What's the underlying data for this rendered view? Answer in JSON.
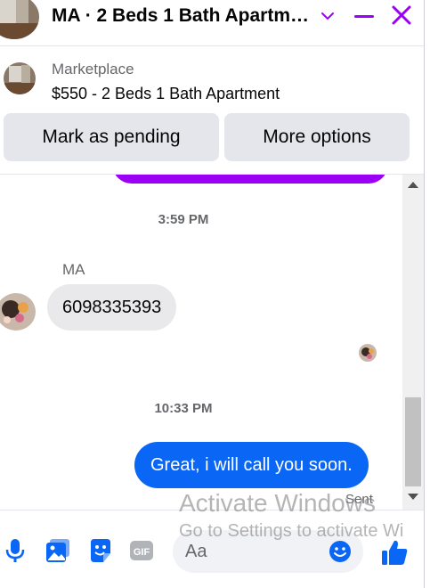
{
  "header": {
    "title": "MA · 2 Beds 1 Bath Apartm…",
    "accent_color": "#9b00f5",
    "icons": [
      "chevron-down-icon",
      "minimize-icon",
      "close-icon"
    ]
  },
  "listing": {
    "source": "Marketplace",
    "title": "$550 - 2 Beds 1 Bath Apartment",
    "buttons": {
      "pending": "Mark as pending",
      "more": "More options"
    }
  },
  "messages": {
    "timestamp_1": "3:59 PM",
    "sender_name": "MA",
    "incoming_text": "6098335393",
    "timestamp_2": "10:33 PM",
    "outgoing_text": "Great, i will call you soon.",
    "sent_label": "Sent",
    "outgoing_color": "#0a66f5",
    "incoming_color": "#e9e9eb"
  },
  "composer": {
    "placeholder": "Aa",
    "icons": [
      "microphone-icon",
      "photo-icon",
      "sticker-icon",
      "gif-icon",
      "emoji-icon",
      "like-icon"
    ],
    "icon_color": "#0a66f5"
  },
  "watermark": {
    "title": "Activate Windows",
    "subtitle": "Go to Settings to activate Wi"
  }
}
